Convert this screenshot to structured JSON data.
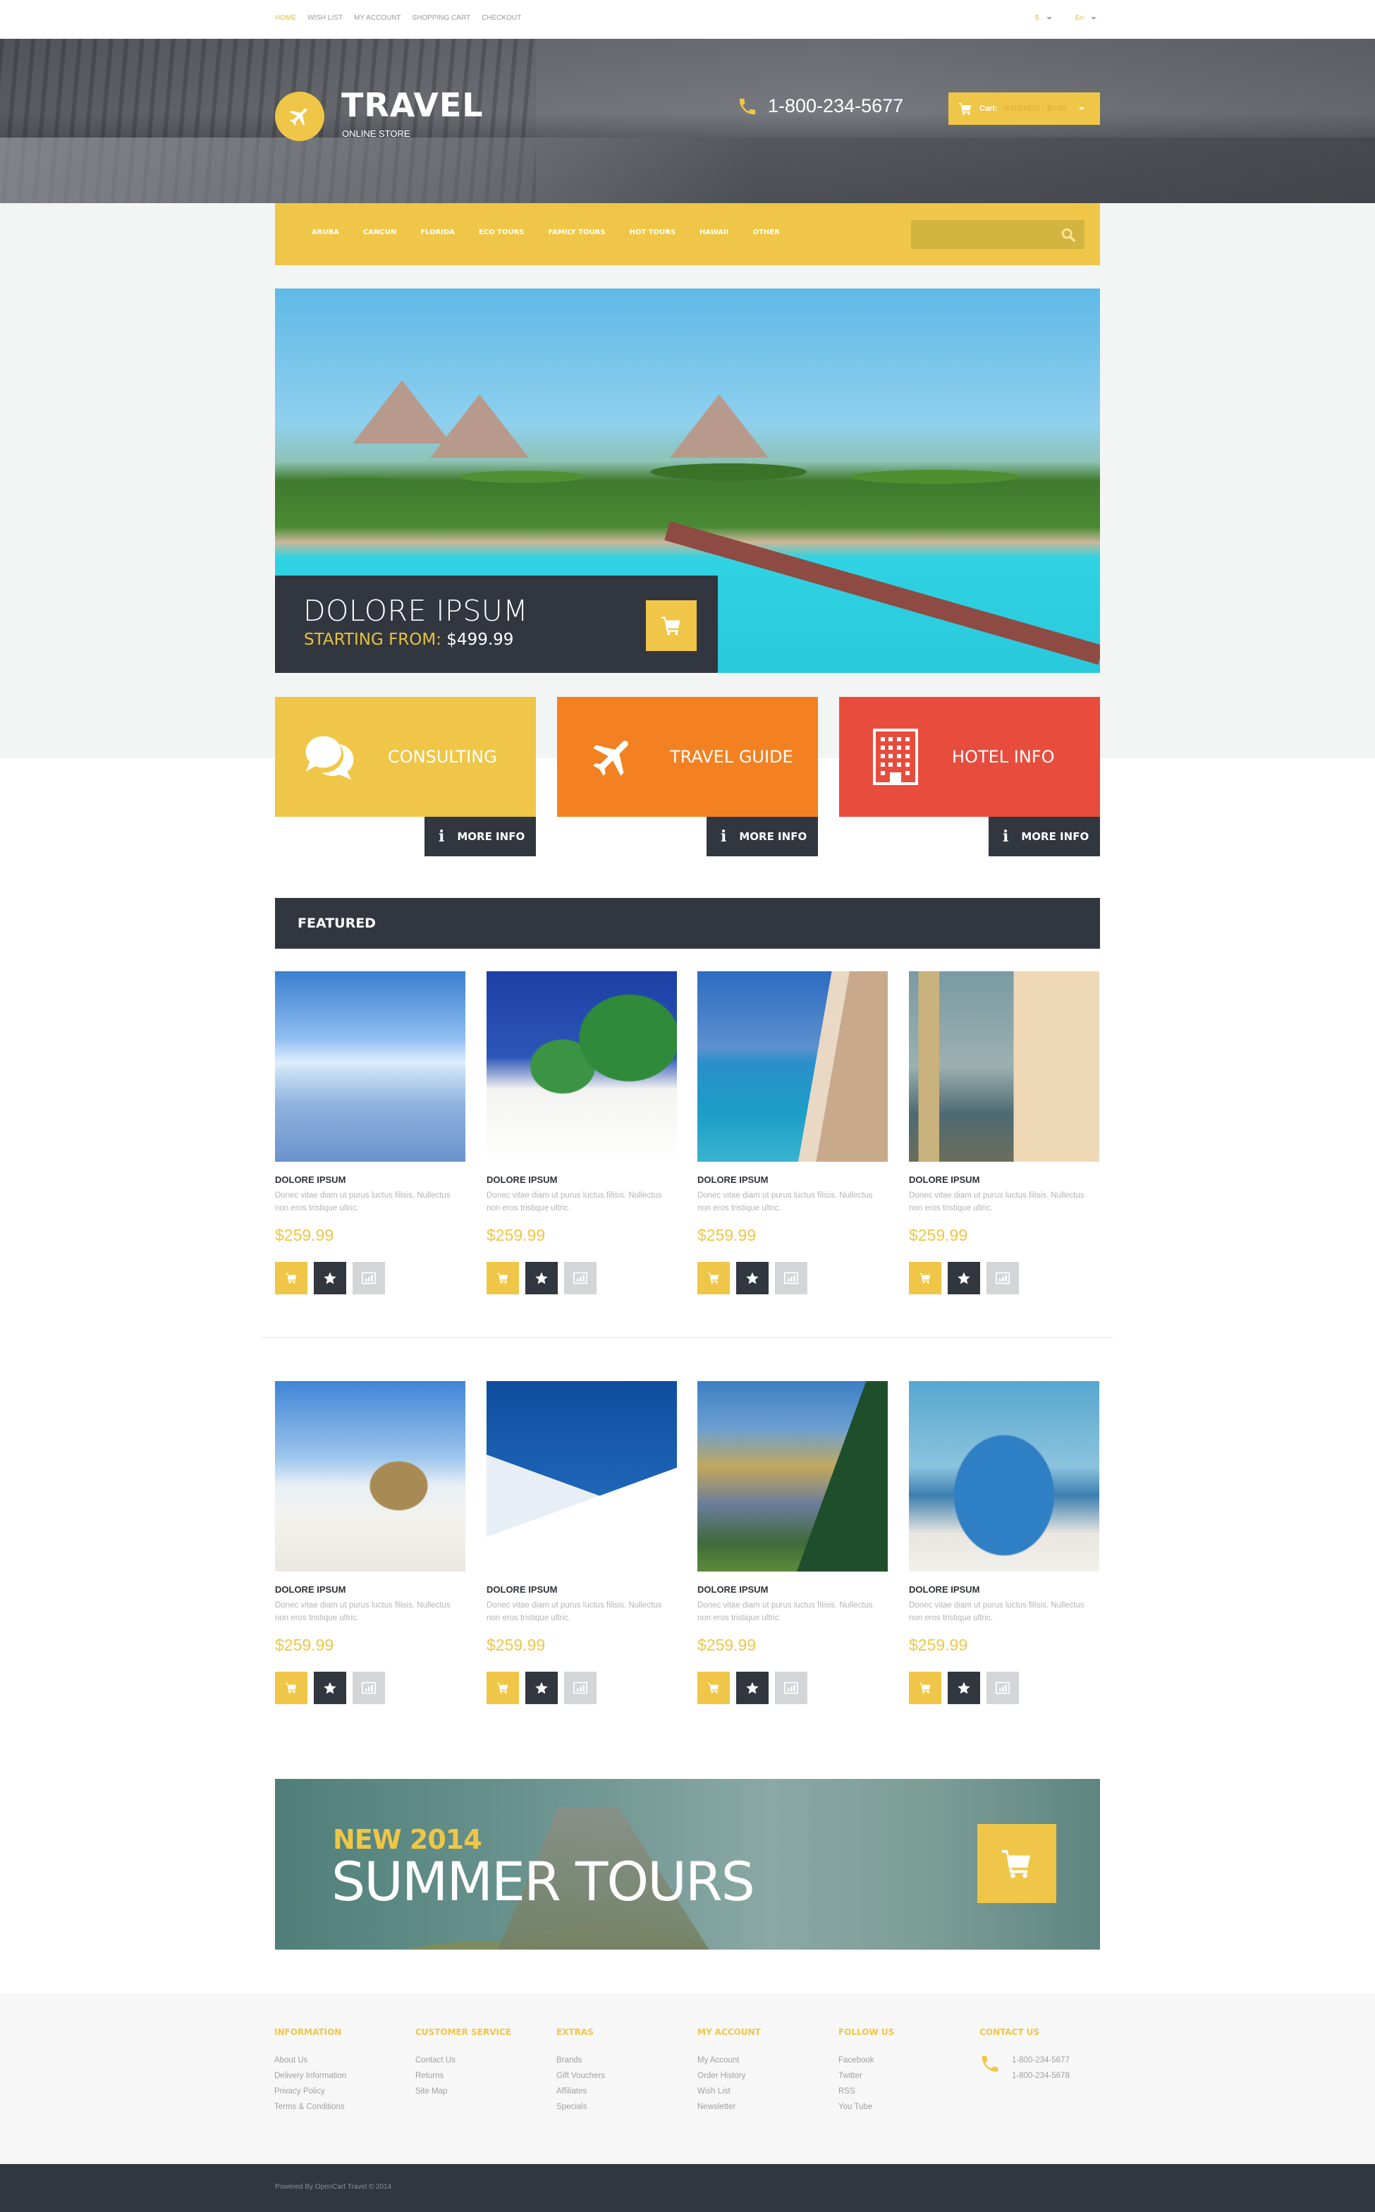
{
  "topbar": {
    "links": [
      {
        "label": "HOME",
        "active": true
      },
      {
        "label": "WISH LIST",
        "active": false
      },
      {
        "label": "MY ACCOUNT",
        "active": false
      },
      {
        "label": "SHOPPING CART",
        "active": false
      },
      {
        "label": "CHECKOUT",
        "active": false
      }
    ],
    "currency": "$",
    "language": "En"
  },
  "header": {
    "brand": "TRAVEL",
    "tagline": "ONLINE STORE",
    "phone": "1-800-234-5677",
    "cart_label": "Cart:",
    "cart_value": "0 ITEM(S) - $0.00"
  },
  "nav": {
    "items": [
      "ARUBA",
      "CANCUN",
      "FLORIDA",
      "ECO TOURS",
      "FAMILY TOURS",
      "HOT TOURS",
      "HAWAII",
      "OTHER"
    ],
    "search_placeholder": ""
  },
  "slider": {
    "title": "DOLORE IPSUM",
    "starting_label": "STARTING FROM:",
    "price": "$499.99"
  },
  "banners": [
    {
      "label": "CONSULTING",
      "icon": "chat-bubbles-icon",
      "color": "#efc647",
      "more": "MORE INFO"
    },
    {
      "label": "TRAVEL GUIDE",
      "icon": "airplane-icon",
      "color": "#f38121",
      "more": "MORE INFO"
    },
    {
      "label": "HOTEL INFO",
      "icon": "building-icon",
      "color": "#e84c3d",
      "more": "MORE INFO"
    }
  ],
  "featured": {
    "title": "FEATURED",
    "products": [
      {
        "name": "DOLORE IPSUM",
        "desc": "Donec vitae diam ut purus luctus filisis. Nullectus non eros tristique ultric.",
        "price": "$259.99",
        "scene": "sky-reflection"
      },
      {
        "name": "DOLORE IPSUM",
        "desc": "Donec vitae diam ut purus luctus filisis. Nullectus non eros tristique ultric.",
        "price": "$259.99",
        "scene": "palm-beach"
      },
      {
        "name": "DOLORE IPSUM",
        "desc": "Donec vitae diam ut purus luctus filisis. Nullectus non eros tristique ultric.",
        "price": "$259.99",
        "scene": "coastline"
      },
      {
        "name": "DOLORE IPSUM",
        "desc": "Donec vitae diam ut purus luctus filisis. Nullectus non eros tristique ultric.",
        "price": "$259.99",
        "scene": "hotel-building"
      },
      {
        "name": "DOLORE IPSUM",
        "desc": "Donec vitae diam ut purus luctus filisis. Nullectus non eros tristique ultric.",
        "price": "$259.99",
        "scene": "beach-huts"
      },
      {
        "name": "DOLORE IPSUM",
        "desc": "Donec vitae diam ut purus luctus filisis. Nullectus non eros tristique ultric.",
        "price": "$259.99",
        "scene": "snowboard"
      },
      {
        "name": "DOLORE IPSUM",
        "desc": "Donec vitae diam ut purus luctus filisis. Nullectus non eros tristique ultric.",
        "price": "$259.99",
        "scene": "marina"
      },
      {
        "name": "DOLORE IPSUM",
        "desc": "Donec vitae diam ut purus luctus filisis. Nullectus non eros tristique ultric.",
        "price": "$259.99",
        "scene": "fishing"
      }
    ]
  },
  "promo": {
    "pre": "NEW 2014",
    "title": "SUMMER TOURS"
  },
  "footer": {
    "columns": [
      {
        "title": "INFORMATION",
        "links": [
          "About Us",
          "Delivery Information",
          "Privacy Policy",
          "Terms & Conditions"
        ]
      },
      {
        "title": "CUSTOMER SERVICE",
        "links": [
          "Contact Us",
          "Returns",
          "Site Map"
        ]
      },
      {
        "title": "EXTRAS",
        "links": [
          "Brands",
          "Gift Vouchers",
          "Affiliates",
          "Specials"
        ]
      },
      {
        "title": "MY ACCOUNT",
        "links": [
          "My Account",
          "Order History",
          "Wish List",
          "Newsletter"
        ]
      },
      {
        "title": "FOLLOW US",
        "links": [
          "Facebook",
          "Twitter",
          "RSS",
          "You Tube"
        ]
      }
    ],
    "contact": {
      "title": "CONTACT US",
      "phones": [
        "1-800-234-5677",
        "1-800-234-5678"
      ]
    },
    "copyright": "Powered By OpenCart Travel © 2014"
  },
  "colors": {
    "accent": "#efc647",
    "dark": "#32363f",
    "orange": "#f38121",
    "red": "#e84c3d"
  }
}
